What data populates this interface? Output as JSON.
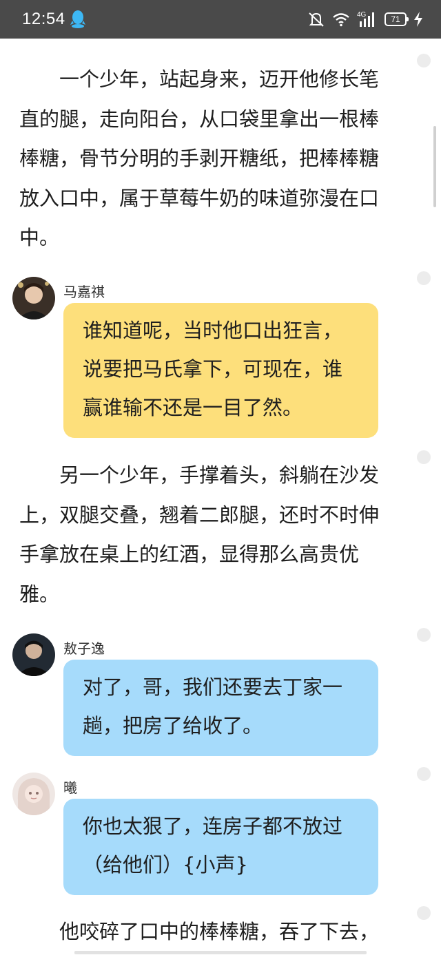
{
  "status_bar": {
    "time": "12:54",
    "battery": "71",
    "network": "4G",
    "icons": [
      "qq-icon",
      "mute-bell-icon",
      "wifi-icon",
      "signal-icon",
      "battery-icon",
      "charging-bolt-icon"
    ]
  },
  "story": [
    {
      "type": "narration",
      "text": "一个少年，站起身来，迈开他修长笔直的腿，走向阳台，从口袋里拿出一根棒棒糖，骨节分明的手剥开糖纸，把棒棒糖放入口中，属于草莓牛奶的味道弥漫在口中。"
    },
    {
      "type": "dialogue",
      "speaker": "马嘉祺",
      "text": "谁知道呢，当时他口出狂言，说要把马氏拿下，可现在，谁赢谁输不还是一目了然。",
      "bubble_color": "#fddf7b"
    },
    {
      "type": "narration",
      "text": "另一个少年，手撑着头，斜躺在沙发上，双腿交叠，翘着二郎腿，还时不时伸手拿放在桌上的红酒，显得那么高贵优雅。"
    },
    {
      "type": "dialogue",
      "speaker": "敖子逸",
      "text": "对了，哥，我们还要去丁家一趟，把房了给收了。",
      "bubble_color": "#a6dbfb"
    },
    {
      "type": "dialogue",
      "speaker": "曦",
      "text": "你也太狠了，连房子都不放过（给他们）{小声}",
      "bubble_color": "#a6dbfb"
    },
    {
      "type": "narration",
      "text": "他咬碎了口中的棒棒糖，吞了下去，"
    }
  ],
  "colors": {
    "status_bar_bg": "#4a4a4a",
    "bubble_yellow": "#fddf7b",
    "bubble_blue": "#a6dbfb"
  }
}
